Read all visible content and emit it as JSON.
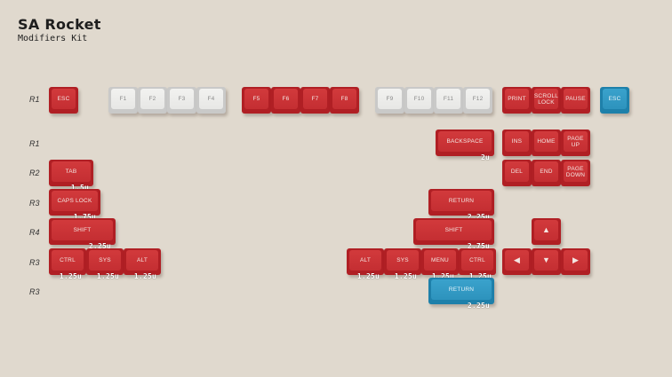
{
  "title": "SA Rocket",
  "subtitle": "Modifiers Kit",
  "row_labels": [
    "R1",
    "R1",
    "R2",
    "R3",
    "R4",
    "R3",
    "R3"
  ],
  "keys": [
    {
      "legend": "ESC",
      "color": "red",
      "size_label": ""
    },
    {
      "legend": "F1",
      "color": "white",
      "size_label": ""
    },
    {
      "legend": "F2",
      "color": "white",
      "size_label": ""
    },
    {
      "legend": "F3",
      "color": "white",
      "size_label": ""
    },
    {
      "legend": "F4",
      "color": "white",
      "size_label": ""
    },
    {
      "legend": "F5",
      "color": "red",
      "size_label": ""
    },
    {
      "legend": "F6",
      "color": "red",
      "size_label": ""
    },
    {
      "legend": "F7",
      "color": "red",
      "size_label": ""
    },
    {
      "legend": "F8",
      "color": "red",
      "size_label": ""
    },
    {
      "legend": "F9",
      "color": "white",
      "size_label": ""
    },
    {
      "legend": "F10",
      "color": "white",
      "size_label": ""
    },
    {
      "legend": "F11",
      "color": "white",
      "size_label": ""
    },
    {
      "legend": "F12",
      "color": "white",
      "size_label": ""
    },
    {
      "legend": "PRINT",
      "color": "red",
      "size_label": ""
    },
    {
      "legend": "SCROLL\nLOCK",
      "color": "red",
      "size_label": ""
    },
    {
      "legend": "PAUSE",
      "color": "red",
      "size_label": ""
    },
    {
      "legend": "ESC",
      "color": "blue",
      "size_label": ""
    },
    {
      "legend": "BACKSPACE",
      "color": "red",
      "size_label": "2u"
    },
    {
      "legend": "INS",
      "color": "red",
      "size_label": ""
    },
    {
      "legend": "HOME",
      "color": "red",
      "size_label": ""
    },
    {
      "legend": "PAGE\nUP",
      "color": "red",
      "size_label": ""
    },
    {
      "legend": "TAB",
      "color": "red",
      "size_label": "1.5u"
    },
    {
      "legend": "DEL",
      "color": "red",
      "size_label": ""
    },
    {
      "legend": "END",
      "color": "red",
      "size_label": ""
    },
    {
      "legend": "PAGE\nDOWN",
      "color": "red",
      "size_label": ""
    },
    {
      "legend": "CAPS  LOCK",
      "color": "red",
      "size_label": "1.75u"
    },
    {
      "legend": "RETURN",
      "color": "red",
      "size_label": "2.25u"
    },
    {
      "legend": "SHIFT",
      "color": "red",
      "size_label": "2.25u"
    },
    {
      "legend": "SHIFT",
      "color": "red",
      "size_label": "2.75u"
    },
    {
      "legend": "▲",
      "color": "red",
      "size_label": ""
    },
    {
      "legend": "CTRL",
      "color": "red",
      "size_label": "1.25u"
    },
    {
      "legend": "SYS",
      "color": "red",
      "size_label": "1.25u"
    },
    {
      "legend": "ALT",
      "color": "red",
      "size_label": "1.25u"
    },
    {
      "legend": "ALT",
      "color": "red",
      "size_label": "1.25u"
    },
    {
      "legend": "SYS",
      "color": "red",
      "size_label": "1.25u"
    },
    {
      "legend": "MENU",
      "color": "red",
      "size_label": "1.25u"
    },
    {
      "legend": "CTRL",
      "color": "red",
      "size_label": "1.25u"
    },
    {
      "legend": "◀",
      "color": "red",
      "size_label": ""
    },
    {
      "legend": "▼",
      "color": "red",
      "size_label": ""
    },
    {
      "legend": "▶",
      "color": "red",
      "size_label": ""
    },
    {
      "legend": "RETURN",
      "color": "blue",
      "size_label": "2.25u"
    }
  ]
}
